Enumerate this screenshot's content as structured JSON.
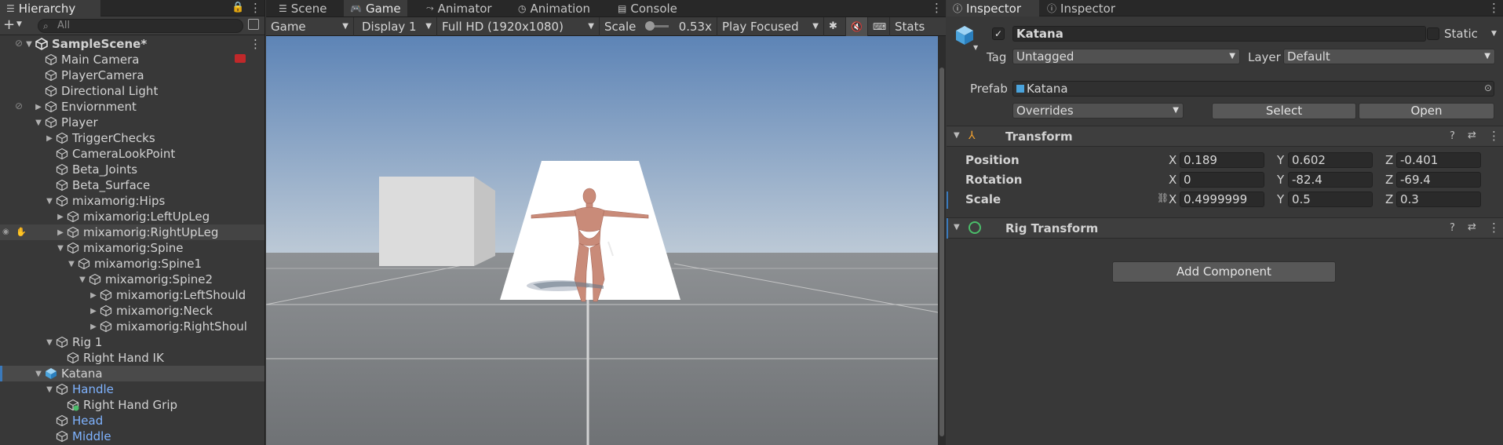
{
  "hierarchy": {
    "tab_label": "Hierarchy",
    "search_placeholder": "All",
    "rows": [
      {
        "label": "SampleScene*",
        "depth": 0,
        "arrow": "▼",
        "icon": "unity-scene-icon",
        "bold": true
      },
      {
        "label": "Main Camera",
        "depth": 2,
        "arrow": "",
        "icon": "gameobject-icon"
      },
      {
        "label": "PlayerCamera",
        "depth": 2,
        "arrow": "",
        "icon": "gameobject-icon"
      },
      {
        "label": "Directional Light",
        "depth": 2,
        "arrow": "",
        "icon": "gameobject-icon"
      },
      {
        "label": "Enviornment",
        "depth": 2,
        "arrow": "▶",
        "icon": "gameobject-icon"
      },
      {
        "label": "Player",
        "depth": 2,
        "arrow": "▼",
        "icon": "gameobject-icon"
      },
      {
        "label": "TriggerChecks",
        "depth": 3,
        "arrow": "▶",
        "icon": "gameobject-icon"
      },
      {
        "label": "CameraLookPoint",
        "depth": 3,
        "arrow": "",
        "icon": "gameobject-icon"
      },
      {
        "label": "Beta_Joints",
        "depth": 3,
        "arrow": "",
        "icon": "gameobject-icon"
      },
      {
        "label": "Beta_Surface",
        "depth": 3,
        "arrow": "",
        "icon": "gameobject-icon"
      },
      {
        "label": "mixamorig:Hips",
        "depth": 3,
        "arrow": "▼",
        "icon": "gameobject-icon"
      },
      {
        "label": "mixamorig:LeftUpLeg",
        "depth": 4,
        "arrow": "▶",
        "icon": "gameobject-icon"
      },
      {
        "label": "mixamorig:RightUpLeg",
        "depth": 4,
        "arrow": "▶",
        "icon": "gameobject-icon"
      },
      {
        "label": "mixamorig:Spine",
        "depth": 4,
        "arrow": "▼",
        "icon": "gameobject-icon"
      },
      {
        "label": "mixamorig:Spine1",
        "depth": 5,
        "arrow": "▼",
        "icon": "gameobject-icon"
      },
      {
        "label": "mixamorig:Spine2",
        "depth": 6,
        "arrow": "▼",
        "icon": "gameobject-icon"
      },
      {
        "label": "mixamorig:LeftShould",
        "depth": 7,
        "arrow": "▶",
        "icon": "gameobject-icon"
      },
      {
        "label": "mixamorig:Neck",
        "depth": 7,
        "arrow": "▶",
        "icon": "gameobject-icon"
      },
      {
        "label": "mixamorig:RightShoul",
        "depth": 7,
        "arrow": "▶",
        "icon": "gameobject-icon"
      },
      {
        "label": "Rig 1",
        "depth": 3,
        "arrow": "▼",
        "icon": "gameobject-icon"
      },
      {
        "label": "Right Hand IK",
        "depth": 4,
        "arrow": "",
        "icon": "gameobject-icon"
      },
      {
        "label": "Katana",
        "depth": 2,
        "arrow": "▼",
        "icon": "prefab-icon",
        "selected": true
      },
      {
        "label": "Handle",
        "depth": 3,
        "arrow": "▼",
        "icon": "gameobject-icon",
        "color": "#7fb3ff"
      },
      {
        "label": "Right Hand Grip",
        "depth": 4,
        "arrow": "",
        "icon": "gameobject-added-icon"
      },
      {
        "label": "Head",
        "depth": 3,
        "arrow": "",
        "icon": "gameobject-icon",
        "color": "#7fb3ff"
      },
      {
        "label": "Middle",
        "depth": 3,
        "arrow": "",
        "icon": "gameobject-icon",
        "color": "#7fb3ff"
      }
    ]
  },
  "scene": {
    "tabs": [
      {
        "label": "Scene",
        "icon": "hamburger-icon"
      },
      {
        "label": "Game",
        "icon": "gamepad-icon",
        "active": true
      },
      {
        "label": "Animator",
        "icon": "animator-icon"
      },
      {
        "label": "Animation",
        "icon": "clock-icon"
      },
      {
        "label": "Console",
        "icon": "console-icon"
      }
    ],
    "toolbar": {
      "view_mode": "Game",
      "display": "Display 1",
      "resolution": "Full HD (1920x1080)",
      "scale_label": "Scale",
      "scale_value": "0.53x",
      "play_mode": "Play Focused",
      "stats": "Stats"
    }
  },
  "inspector": {
    "tabs": [
      "Inspector",
      "Inspector"
    ],
    "object_name": "Katana",
    "static_label": "Static",
    "tag_label": "Tag",
    "tag_value": "Untagged",
    "layer_label": "Layer",
    "layer_value": "Default",
    "prefab_label": "Prefab",
    "prefab_value": "Katana",
    "overrides_label": "Overrides",
    "select_label": "Select",
    "open_label": "Open",
    "transform": {
      "title": "Transform",
      "rows": [
        {
          "label": "Position",
          "x": "0.189",
          "y": "0.602",
          "z": "-0.401"
        },
        {
          "label": "Rotation",
          "x": "0",
          "y": "-82.4",
          "z": "-69.4"
        },
        {
          "label": "Scale",
          "x": "0.4999999",
          "y": "0.5",
          "z": "0.3"
        }
      ]
    },
    "rig_transform_title": "Rig Transform",
    "add_component_label": "Add Component",
    "axis_labels": [
      "X",
      "Y",
      "Z"
    ]
  }
}
